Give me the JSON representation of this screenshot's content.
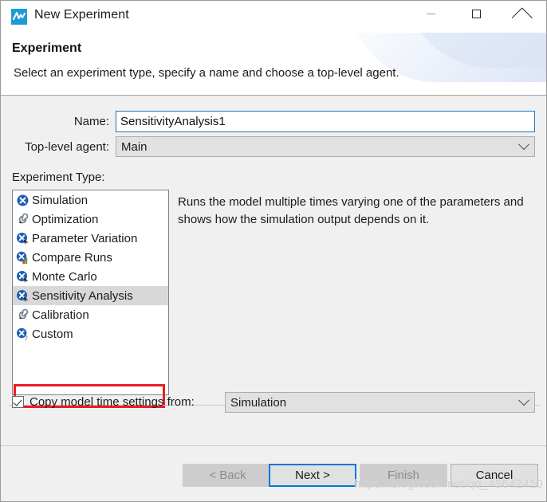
{
  "window": {
    "title": "New Experiment",
    "icon": "anylogic-logo-icon",
    "controls": {
      "minimize": "minimize-icon",
      "maximize": "maximize-icon",
      "close": "close-icon"
    }
  },
  "header": {
    "title": "Experiment",
    "description": "Select an experiment type, specify a name and choose a top-level agent."
  },
  "form": {
    "name_label": "Name:",
    "name_value": "SensitivityAnalysis1",
    "agent_label": "Top-level agent:",
    "agent_value": "Main",
    "agent_options": [
      "Main"
    ],
    "experiment_type_label": "Experiment Type:"
  },
  "experiment_types": {
    "items": [
      {
        "label": "Simulation",
        "icon": "experiment-simulation-icon",
        "selected": false
      },
      {
        "label": "Optimization",
        "icon": "experiment-optimization-icon",
        "selected": false
      },
      {
        "label": "Parameter Variation",
        "icon": "experiment-variation-icon",
        "selected": false
      },
      {
        "label": "Compare Runs",
        "icon": "experiment-compare-icon",
        "selected": false
      },
      {
        "label": "Monte Carlo",
        "icon": "experiment-variation-icon",
        "selected": false
      },
      {
        "label": "Sensitivity Analysis",
        "icon": "experiment-variation-icon",
        "selected": true
      },
      {
        "label": "Calibration",
        "icon": "experiment-optimization-icon",
        "selected": false
      },
      {
        "label": "Custom",
        "icon": "experiment-custom-icon",
        "selected": false
      }
    ],
    "selected_index": 5,
    "description": "Runs the model multiple times varying one of the parameters and shows how the simulation output depends on it."
  },
  "copy_settings": {
    "checked": true,
    "label": "Copy model time settings from:",
    "value": "Simulation",
    "options": [
      "Simulation"
    ]
  },
  "footer": {
    "buttons": [
      {
        "label": "< Back",
        "state": "disabled"
      },
      {
        "label": "Next >",
        "state": "focused"
      },
      {
        "label": "Finish",
        "state": "disabled"
      },
      {
        "label": "Cancel",
        "state": "enabled"
      }
    ]
  },
  "watermark": "https://blog.csdn.net/qq_45642410",
  "colors": {
    "accent": "#0078d7",
    "annotation_red": "#ed1c24",
    "icon_blue": "#1b5fb4",
    "logo_blue": "#1e9bd7"
  }
}
